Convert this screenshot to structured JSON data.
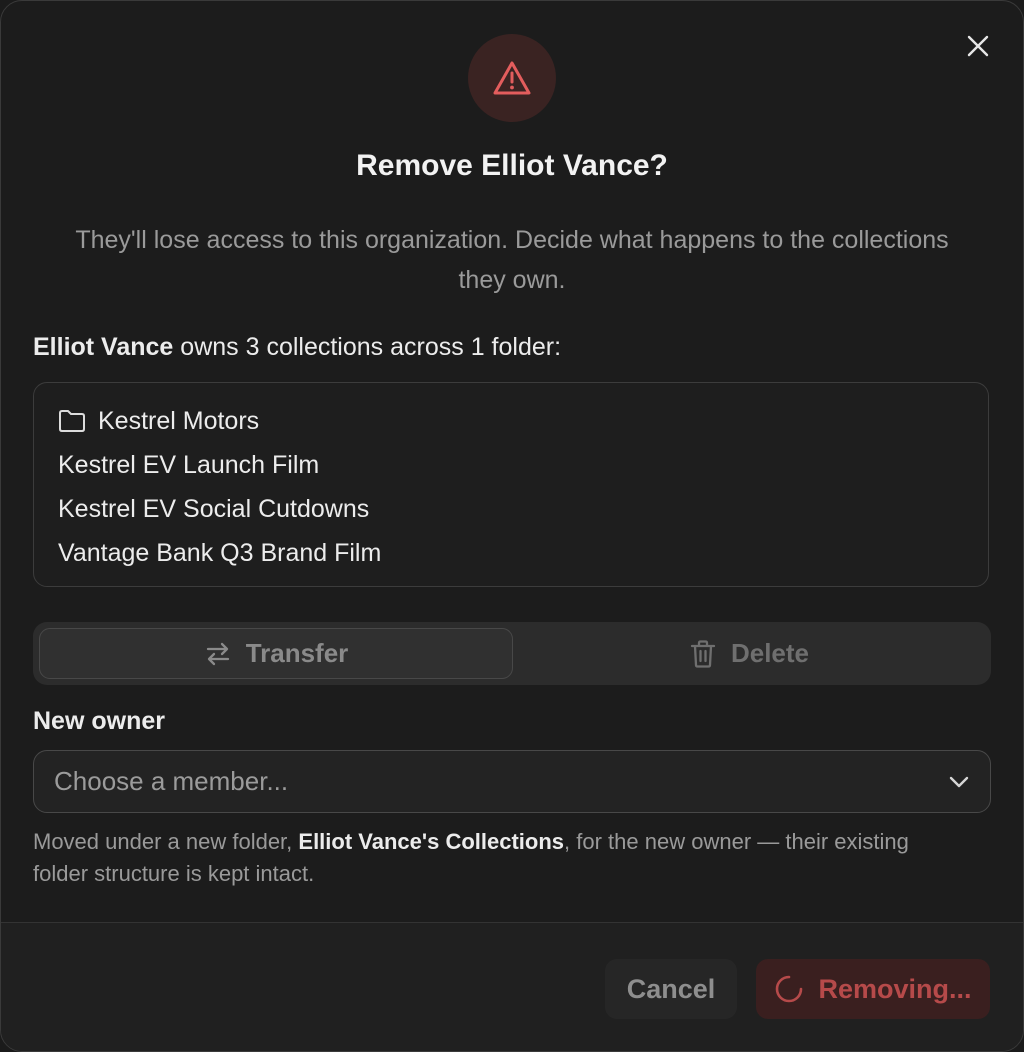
{
  "dialog": {
    "title": "Remove Elliot Vance?",
    "subtitle": "They'll lose access to this organization. Decide what happens to the collections they own.",
    "member_name": "Elliot Vance",
    "owns_summary": " owns 3 collections across 1 folder:",
    "icons": {
      "warning": "warning-triangle-icon",
      "close": "close-icon"
    },
    "accent_color": "#e35d5d"
  },
  "collections": {
    "folder_name": "Kestrel Motors",
    "items": [
      "Kestrel EV Launch Film",
      "Kestrel EV Social Cutdowns",
      "Vantage Bank Q3 Brand Film"
    ]
  },
  "action_toggle": {
    "transfer_label": "Transfer",
    "delete_label": "Delete",
    "selected": "Transfer"
  },
  "new_owner": {
    "label": "New owner",
    "placeholder": "Choose a member..."
  },
  "hint": {
    "prefix": "Moved under a new folder, ",
    "folder_name": "Elliot Vance's Collections",
    "suffix": ", for the new owner — their existing folder structure is kept intact."
  },
  "footer": {
    "cancel_label": "Cancel",
    "remove_label": "Removing..."
  }
}
